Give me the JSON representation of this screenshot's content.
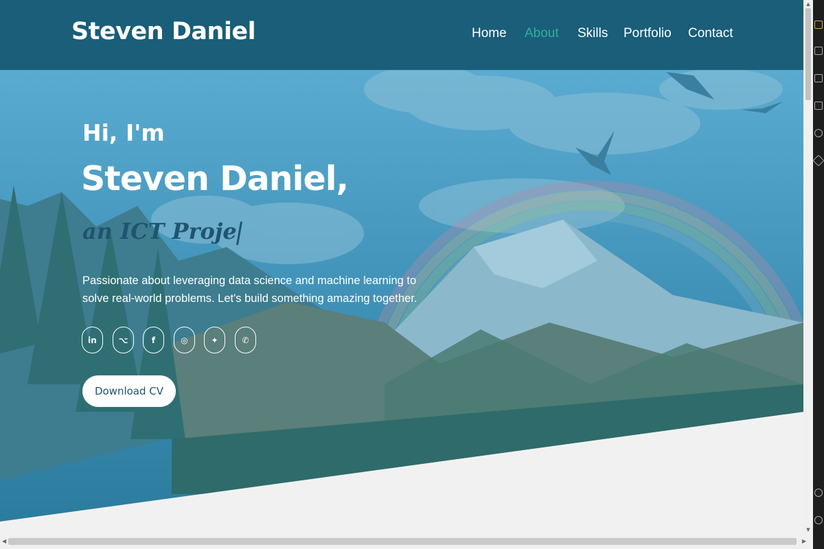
{
  "brand": "Steven Daniel",
  "nav": [
    {
      "label": "Home",
      "active": false
    },
    {
      "label": "About",
      "active": true
    },
    {
      "label": "Skills",
      "active": false
    },
    {
      "label": "Portfolio",
      "active": false
    },
    {
      "label": "Contact",
      "active": false
    }
  ],
  "hero": {
    "greeting": "Hi, I'm",
    "name": "Steven Daniel,",
    "typing_text": "an ICT Proje",
    "tagline": "Passionate about leveraging data science and machine learning to solve real-world problems. Let's build something amazing together.",
    "cv_button": "Download CV"
  },
  "socials": [
    {
      "icon": "linkedin-icon",
      "glyph": "in"
    },
    {
      "icon": "github-icon",
      "glyph": "⌥"
    },
    {
      "icon": "facebook-icon",
      "glyph": "f"
    },
    {
      "icon": "instagram-icon",
      "glyph": "◎"
    },
    {
      "icon": "twitter-icon",
      "glyph": "✦"
    },
    {
      "icon": "whatsapp-icon",
      "glyph": "✆"
    }
  ],
  "colors": {
    "navbar": "#1a5e79",
    "accent": "#2bb39a",
    "sky": "#5aaed3",
    "section_bg": "#f2f1f1"
  }
}
